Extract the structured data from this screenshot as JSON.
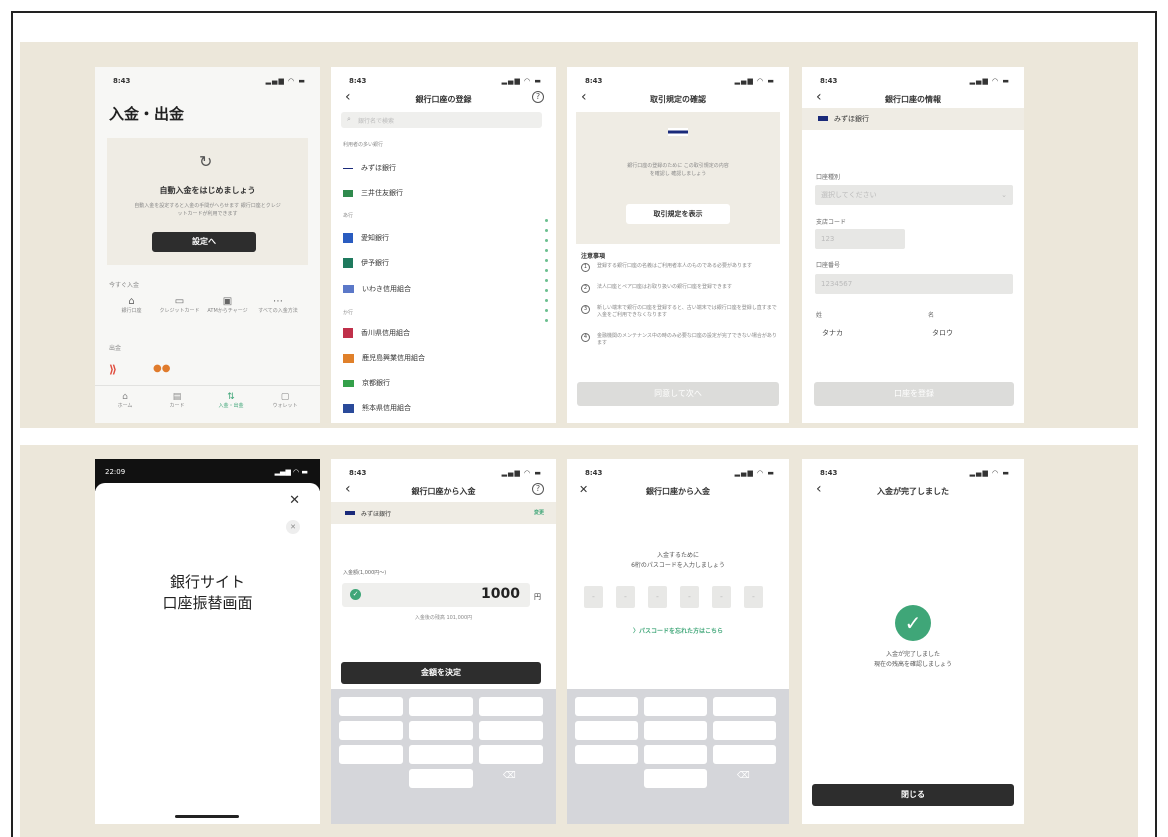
{
  "screens": {
    "s1": {
      "time": "8:43",
      "title": "入金・出金",
      "banner_title": "自動入金をはじめましょう",
      "banner_desc": "自動入金を設定すると入金の手間がへらせます 銀行口座とクレジットカードが利用できます",
      "setup_button": "設定へ",
      "section_label": "今すぐ入金",
      "quick_items": [
        "銀行口座",
        "クレジットカード",
        "ATMからチャージ",
        "すべての入金方法"
      ],
      "section2_label": "出金",
      "tabs": [
        "ホーム",
        "カード",
        "入金・出金",
        "ウォレット"
      ]
    },
    "s2": {
      "time": "8:43",
      "title": "銀行口座の登録",
      "search_placeholder": "銀行名で検索",
      "section_favorites": "利用者の多い銀行",
      "banks_top": [
        "みずほ銀行",
        "三井住友銀行"
      ],
      "section_a": "あ行",
      "banks_a": [
        "愛知銀行",
        "伊予銀行",
        "いわき信用組合"
      ],
      "section_ka": "か行",
      "banks_ka": [
        "香川県信用組合",
        "鹿児島興業信用組合",
        "京都銀行",
        "熊本県信用組合"
      ]
    },
    "s3": {
      "time": "8:43",
      "title": "取引規定の確認",
      "card_text": "銀行口座の登録のために この取引規定の内容を確認し 確認しましょう",
      "show_button": "取引規定を表示",
      "notes_title": "注意事項",
      "notes": [
        "登録する銀行口座の名義はご利用者本人のものである必要があります",
        "法人口座とペア口座はお取り扱いの銀行口座を登録できます",
        "新しい端末で銀行の口座を登録すると、古い端末では銀行口座を登録し直すまで入金をご利用できなくなります",
        "金融機関のメンテナンス中の時のみ必要な口座の設定が完了できない場合があります"
      ],
      "agree_button": "同意して次へ"
    },
    "s4": {
      "time": "8:43",
      "title": "銀行口座の情報",
      "bank": "みずほ銀行",
      "type_label": "口座種別",
      "type_placeholder": "選択してください",
      "branch_label": "支店コード",
      "branch_placeholder": "123",
      "number_label": "口座番号",
      "number_placeholder": "1234567",
      "sei_label": "姓",
      "mei_label": "名",
      "sei_value": "タナカ",
      "mei_value": "タロウ",
      "register_button": "口座を登録"
    },
    "s5": {
      "time": "22:09",
      "title_line1": "銀行サイト",
      "title_line2": "口座振替画面"
    },
    "s6": {
      "time": "8:43",
      "title": "銀行口座から入金",
      "bank": "みずほ銀行",
      "bank_tag": "変更",
      "amount_label": "入金額(1,000円〜)",
      "amount": "1000",
      "unit": "円",
      "limit_note": "入金後の残高 101,000円",
      "confirm_button": "金額を決定"
    },
    "s7": {
      "time": "8:43",
      "title": "銀行口座から入金",
      "prompt_line1": "入金するために",
      "prompt_line2": "6桁のパスコードを入力しましょう",
      "forgot_link": "パスコードを忘れた方はこちら"
    },
    "s8": {
      "time": "8:43",
      "title": "入金が完了しました",
      "done_line1": "入金が完了しました",
      "done_line2": "現在の残高を確認しましょう",
      "close_button": "閉じる"
    }
  },
  "colors": {
    "strip_bg": "#ece7da",
    "accent_green": "#3fa678",
    "dark_button": "#2d2d2d"
  }
}
